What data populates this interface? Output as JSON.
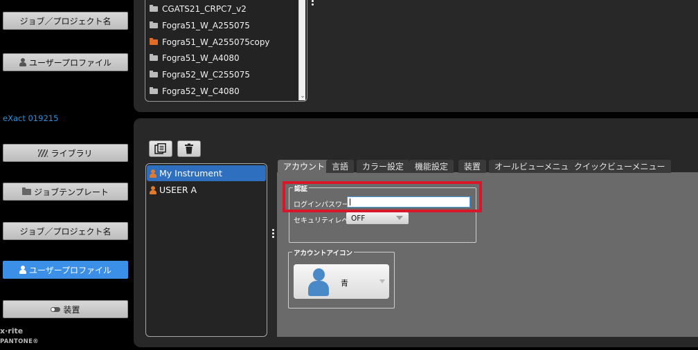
{
  "sidebar": {
    "buttons": [
      {
        "label": "ジョブ／プロジェクト名"
      },
      {
        "label": "ユーザープロファイル"
      },
      {
        "label": "ライブラリ"
      },
      {
        "label": "ジョブテンプレート"
      },
      {
        "label": "ジョブ／プロジェクト名"
      },
      {
        "label": "ユーザープロファイル"
      },
      {
        "label": "装置"
      }
    ],
    "device_name": "eXact 019215",
    "brand": "x·rite",
    "brand_sub": "PANTONE®"
  },
  "file_list": {
    "items": [
      {
        "name": "CGATS21_CRPC7_v2"
      },
      {
        "name": "Fogra51_W_A255075"
      },
      {
        "name": "Fogra51_W_A255075copy"
      },
      {
        "name": "Fogra51_W_A4080"
      },
      {
        "name": "Fogra52_W_C255075"
      },
      {
        "name": "Fogra52_W_C4080"
      }
    ]
  },
  "users": {
    "items": [
      {
        "name": "My Instrument"
      },
      {
        "name": "USEER A"
      }
    ]
  },
  "tabs": [
    {
      "label": "アカウント"
    },
    {
      "label": "言語"
    },
    {
      "label": "カラー設定"
    },
    {
      "label": "機能設定"
    },
    {
      "label": "装置"
    },
    {
      "label": "オールビューメニュー"
    },
    {
      "label": "クイックビューメニュー"
    }
  ],
  "account": {
    "auth_group": "認証",
    "login_password_label": "ログインパスワード",
    "login_password_value": "",
    "security_level_label": "セキュリティレベル",
    "security_level_value": "OFF",
    "icon_group": "アカウントアイコン",
    "icon_value": "青"
  },
  "colors": {
    "accent": "#3b8fe6",
    "selected_row": "#2e6fc0",
    "highlight": "#d8182a",
    "user_icon": "#e07a2c",
    "account_icon": "#4a89c7"
  }
}
